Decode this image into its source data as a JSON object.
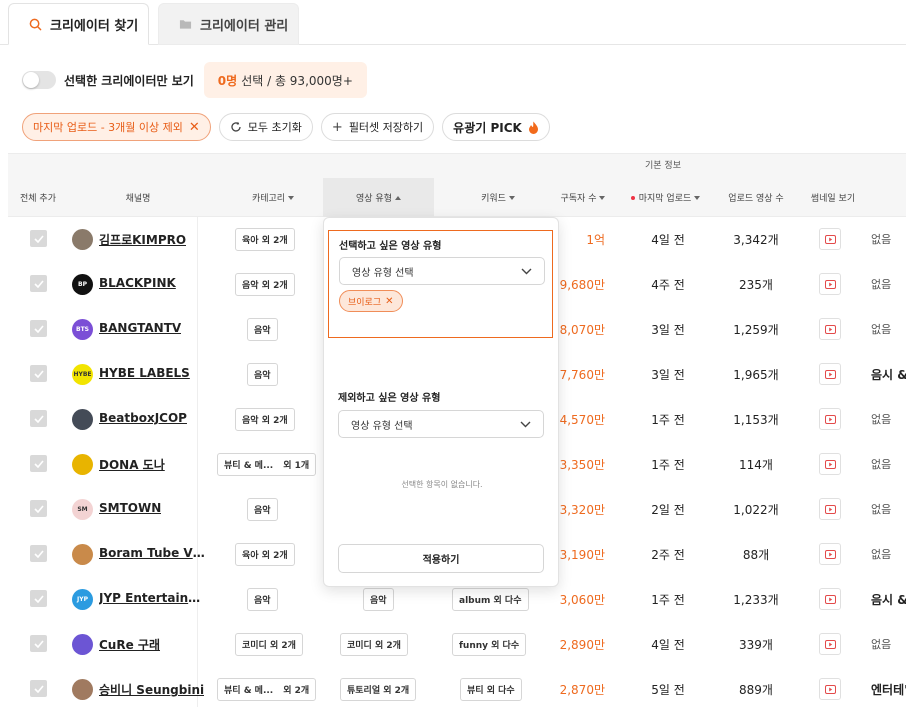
{
  "tabs": [
    {
      "label": "크리에이터 찾기",
      "active": true,
      "icon": "search-icon"
    },
    {
      "label": "크리에이터 관리",
      "active": false,
      "icon": "folder-icon"
    }
  ],
  "toolbar": {
    "toggle_label": "선택한 크리에이터만 보기",
    "selected_count": "0명",
    "selected_rest": "선택 / 총 93,000명+",
    "filter_chip": "마지막 업로드 - 3개월 이상 제외",
    "reset_label": "모두 초기화",
    "save_filter_label": "필터셋 저장하기",
    "pick_label": "유광기 PICK",
    "accent_color": "#ee6a1f"
  },
  "table": {
    "group_header": "기본 정보",
    "headers": {
      "add_all": "전체 추가",
      "channel": "채널명",
      "category": "카테고리",
      "video_type": "영상 유형",
      "keyword": "키워드",
      "subscribers": "구독자 수",
      "last_upload": "마지막 업로드",
      "video_count": "업로드 영상 수",
      "thumbnail": "썸네일 보기"
    },
    "rows": [
      {
        "name": "김프로KIMPRO",
        "category": "육아 외 2개",
        "video_type": "",
        "keyword": "",
        "subscribers": "1억",
        "last_upload": "4일 전",
        "video_count": "3,342개",
        "extra": "없음",
        "extra_bold": false,
        "avatar_text": "",
        "avatar_color": "#8a7a6a"
      },
      {
        "name": "BLACKPINK",
        "category": "음악 외 2개",
        "video_type": "",
        "keyword": "",
        "subscribers": "9,680만",
        "last_upload": "4주 전",
        "video_count": "235개",
        "extra": "없음",
        "extra_bold": false,
        "avatar_text": "BP",
        "avatar_color": "#111111"
      },
      {
        "name": "BANGTANTV",
        "category": "음악",
        "video_type": "",
        "keyword": "",
        "subscribers": "8,070만",
        "last_upload": "3일 전",
        "video_count": "1,259개",
        "extra": "없음",
        "extra_bold": false,
        "avatar_text": "BTS",
        "avatar_color": "#7b4fd6"
      },
      {
        "name": "HYBE LABELS",
        "category": "음악",
        "video_type": "",
        "keyword": "",
        "subscribers": "7,760만",
        "last_upload": "3일 전",
        "video_count": "1,965개",
        "extra": "음시 &",
        "extra_bold": true,
        "avatar_text": "HYBE",
        "avatar_color": "#f2e400"
      },
      {
        "name": "BeatboxJCOP",
        "category": "음악 외 2개",
        "video_type": "",
        "keyword": "",
        "subscribers": "4,570만",
        "last_upload": "1주 전",
        "video_count": "1,153개",
        "extra": "없음",
        "extra_bold": false,
        "avatar_text": "",
        "avatar_color": "#444b57"
      },
      {
        "name": "DONA 도나",
        "category": "뷰티 & 메...",
        "category_extra": "외 1개",
        "video_type": "",
        "keyword": "",
        "subscribers": "3,350만",
        "last_upload": "1주 전",
        "video_count": "114개",
        "extra": "없음",
        "extra_bold": false,
        "avatar_text": "",
        "avatar_color": "#e8b400"
      },
      {
        "name": "SMTOWN",
        "category": "음악",
        "video_type": "",
        "keyword": "",
        "subscribers": "3,320만",
        "last_upload": "2일 전",
        "video_count": "1,022개",
        "extra": "없음",
        "extra_bold": false,
        "avatar_text": "SM",
        "avatar_color": "#f3d3d3"
      },
      {
        "name": "Boram Tube Vlo...",
        "category": "육아 외 2개",
        "video_type": "",
        "keyword": "",
        "subscribers": "3,190만",
        "last_upload": "2주 전",
        "video_count": "88개",
        "extra": "없음",
        "extra_bold": false,
        "avatar_text": "",
        "avatar_color": "#c98a4a"
      },
      {
        "name": "JYP Entertainm...",
        "category": "음악",
        "video_type": "음악",
        "keyword": "album 외 다수",
        "subscribers": "3,060만",
        "last_upload": "1주 전",
        "video_count": "1,233개",
        "extra": "음시 &",
        "extra_bold": true,
        "avatar_text": "JYP",
        "avatar_color": "#2b9be0"
      },
      {
        "name": "CuRe 구래",
        "category": "코미디 외 2개",
        "video_type": "코미디 외 2개",
        "keyword": "funny 외 다수",
        "subscribers": "2,890만",
        "last_upload": "4일 전",
        "video_count": "339개",
        "extra": "없음",
        "extra_bold": false,
        "avatar_text": "",
        "avatar_color": "#6c55d4"
      },
      {
        "name": "승비니 Seungbini",
        "category": "뷰티 & 메...",
        "category_extra": "외 2개",
        "video_type": "튜토리얼 외 2개",
        "keyword": "뷰티 외 다수",
        "subscribers": "2,870만",
        "last_upload": "5일 전",
        "video_count": "889개",
        "extra": "엔터테\"",
        "extra_bold": true,
        "avatar_text": "",
        "avatar_color": "#a07a60"
      }
    ]
  },
  "popup": {
    "include_label": "선택하고 싶은 영상 유형",
    "include_placeholder": "영상 유형 선택",
    "selected_tag": "브이로그",
    "exclude_label": "제외하고 싶은 영상 유형",
    "exclude_placeholder": "영상 유형 선택",
    "empty_message": "선택한 항목이 없습니다.",
    "apply_label": "적용하기"
  }
}
